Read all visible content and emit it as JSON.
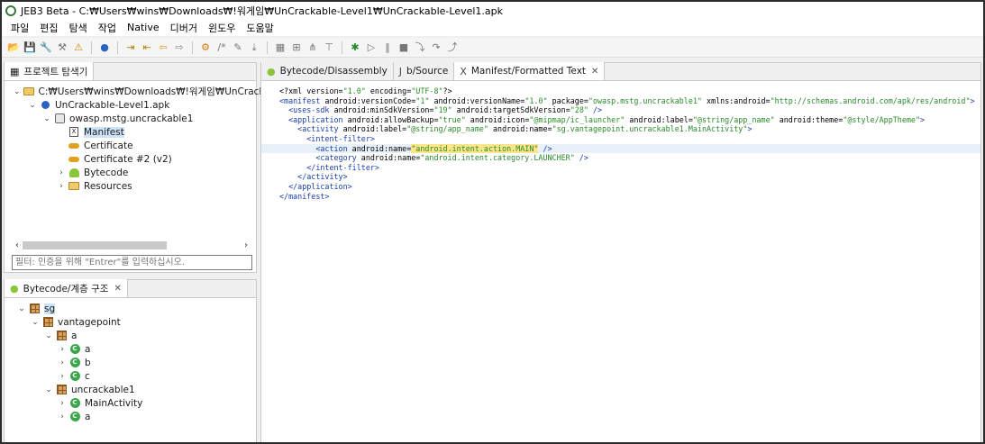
{
  "window": {
    "title": "JEB3 Beta - C:₩Users₩wins₩Downloads₩!워게임₩UnCrackable-Level1₩UnCrackable-Level1.apk"
  },
  "menu": [
    "파일",
    "편집",
    "탐색",
    "작업",
    "Native",
    "디버거",
    "윈도우",
    "도움말"
  ],
  "toolbar_icons": [
    "open-icon",
    "save-icon",
    "wrench-icon",
    "tools-icon",
    "warning-icon",
    "globe-icon",
    "navigate-into-icon",
    "navigate-out-icon",
    "back-icon",
    "forward-icon",
    "analyze-icon",
    "comment-icon",
    "rename-icon",
    "export-icon",
    "layout-icon",
    "graph-icon",
    "hierarchy-icon",
    "tree-icon",
    "debug-icon",
    "run-icon",
    "pause-icon",
    "stop-icon",
    "step-into-icon",
    "step-over-icon",
    "step-out-icon"
  ],
  "project_explorer": {
    "tab_label": "프로젝트 탐색기",
    "tree": [
      {
        "label": "C:₩Users₩wins₩Downloads₩!워게임₩UnCrackable-L",
        "level": 0,
        "twisty": "v",
        "icon": "folder-open-icon"
      },
      {
        "label": "UnCrackable-Level1.apk",
        "level": 1,
        "twisty": "v",
        "icon": "apk-icon"
      },
      {
        "label": "owasp.mstg.uncrackable1",
        "level": 2,
        "twisty": "v",
        "icon": "package-icon"
      },
      {
        "label": "Manifest",
        "level": 3,
        "twisty": "",
        "icon": "manifest-icon",
        "selected": true
      },
      {
        "label": "Certificate",
        "level": 3,
        "twisty": "",
        "icon": "key-icon"
      },
      {
        "label": "Certificate #2 (v2)",
        "level": 3,
        "twisty": "",
        "icon": "key-icon"
      },
      {
        "label": "Bytecode",
        "level": 3,
        "twisty": ">",
        "icon": "android-icon"
      },
      {
        "label": "Resources",
        "level": 3,
        "twisty": ">",
        "icon": "folder-icon"
      }
    ],
    "filter_placeholder": "필터: 인증을 위해 \"Entrer\"를 입력하십시오."
  },
  "hierarchy": {
    "tab_label": "Bytecode/계층 구조",
    "tree": [
      {
        "label": "sg",
        "level": 0,
        "twisty": "v",
        "icon": "package-icon",
        "selected": true
      },
      {
        "label": "vantagepoint",
        "level": 1,
        "twisty": "v",
        "icon": "package-icon"
      },
      {
        "label": "a",
        "level": 2,
        "twisty": "v",
        "icon": "package-icon"
      },
      {
        "label": "a",
        "level": 3,
        "twisty": ">",
        "icon": "class-icon"
      },
      {
        "label": "b",
        "level": 3,
        "twisty": ">",
        "icon": "class-icon"
      },
      {
        "label": "c",
        "level": 3,
        "twisty": ">",
        "icon": "class-icon"
      },
      {
        "label": "uncrackable1",
        "level": 2,
        "twisty": "v",
        "icon": "package-icon"
      },
      {
        "label": "MainActivity",
        "level": 3,
        "twisty": ">",
        "icon": "class-icon"
      },
      {
        "label": "a",
        "level": 3,
        "twisty": ">",
        "icon": "class-icon"
      }
    ]
  },
  "editor": {
    "tabs": [
      {
        "label": "Bytecode/Disassembly",
        "icon": "android-icon",
        "active": false,
        "closable": false
      },
      {
        "label": "b/Source",
        "icon": "source-icon",
        "active": false,
        "closable": false
      },
      {
        "label": "Manifest/Formatted Text",
        "icon": "manifest-icon",
        "active": true,
        "closable": true
      }
    ],
    "lines": [
      {
        "indent": "",
        "parts": [
          [
            "p",
            "<?xml version="
          ],
          [
            "s",
            "\"1.0\""
          ],
          [
            "p",
            " encoding="
          ],
          [
            "s",
            "\"UTF-8\""
          ],
          [
            "p",
            "?>"
          ]
        ]
      },
      {
        "indent": "",
        "parts": [
          [
            "t",
            "<manifest"
          ],
          [
            "a",
            " android:versionCode="
          ],
          [
            "s",
            "\"1\""
          ],
          [
            "a",
            " android:versionName="
          ],
          [
            "s",
            "\"1.0\""
          ],
          [
            "a",
            " package="
          ],
          [
            "s",
            "\"owasp.mstg.uncrackable1\""
          ],
          [
            "a",
            " xmlns:android="
          ],
          [
            "s",
            "\"http://schemas.android.com/apk/res/android\""
          ],
          [
            "t",
            ">"
          ]
        ]
      },
      {
        "indent": "  ",
        "parts": [
          [
            "t",
            "<uses-sdk"
          ],
          [
            "a",
            " android:minSdkVersion="
          ],
          [
            "s",
            "\"19\""
          ],
          [
            "a",
            " android:targetSdkVersion="
          ],
          [
            "s",
            "\"28\""
          ],
          [
            "t",
            " />"
          ]
        ]
      },
      {
        "indent": "  ",
        "parts": [
          [
            "t",
            "<application"
          ],
          [
            "a",
            " android:allowBackup="
          ],
          [
            "s",
            "\"true\""
          ],
          [
            "a",
            " android:icon="
          ],
          [
            "s",
            "\"@mipmap/ic_launcher\""
          ],
          [
            "a",
            " android:label="
          ],
          [
            "s",
            "\"@string/app_name\""
          ],
          [
            "a",
            " android:theme="
          ],
          [
            "s",
            "\"@style/AppTheme\""
          ],
          [
            "t",
            ">"
          ]
        ]
      },
      {
        "indent": "    ",
        "parts": [
          [
            "t",
            "<activity"
          ],
          [
            "a",
            " android:label="
          ],
          [
            "s",
            "\"@string/app_name\""
          ],
          [
            "a",
            " android:name="
          ],
          [
            "s",
            "\"sg.vantagepoint.uncrackable1.MainActivity\""
          ],
          [
            "t",
            ">"
          ]
        ]
      },
      {
        "indent": "      ",
        "parts": [
          [
            "t",
            "<intent-filter>"
          ]
        ]
      },
      {
        "indent": "        ",
        "highlight": true,
        "parts": [
          [
            "t",
            "<action"
          ],
          [
            "a",
            " android:name="
          ],
          [
            "h",
            "\"android.intent.action.MAIN\""
          ],
          [
            "t",
            " />"
          ]
        ]
      },
      {
        "indent": "        ",
        "parts": [
          [
            "t",
            "<category"
          ],
          [
            "a",
            " android:name="
          ],
          [
            "s",
            "\"android.intent.category.LAUNCHER\""
          ],
          [
            "t",
            " />"
          ]
        ]
      },
      {
        "indent": "      ",
        "parts": [
          [
            "t",
            "</intent-filter>"
          ]
        ]
      },
      {
        "indent": "    ",
        "parts": [
          [
            "t",
            "</activity>"
          ]
        ]
      },
      {
        "indent": "  ",
        "parts": [
          [
            "t",
            "</application>"
          ]
        ]
      },
      {
        "indent": "",
        "parts": [
          [
            "t",
            "</manifest>"
          ]
        ]
      }
    ]
  }
}
